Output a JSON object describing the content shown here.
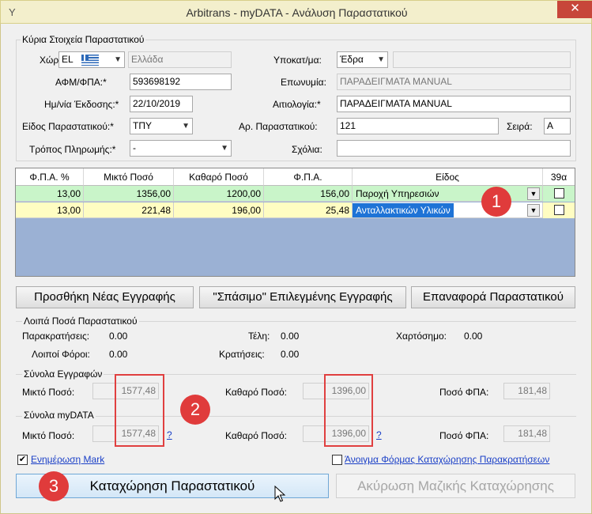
{
  "window": {
    "title": "Arbitrans - myDATA - Ανάλυση Παραστατικού",
    "close_glyph": "✕",
    "app_glyph": "Y"
  },
  "main_details": {
    "legend": "Κύρια Στοιχεία Παραστατικού",
    "country_label": "Χώρα:",
    "country_code": "EL",
    "country_name": "Ελλάδα",
    "vat_label": "ΑΦΜ/ΦΠΑ:*",
    "vat_value": "593698192",
    "date_label": "Ημ/νία Έκδοσης:*",
    "date_value": "22/10/2019",
    "doc_type_label": "Είδος Παραστατικού:*",
    "doc_type_value": "ΤΠΥ",
    "payment_label": "Τρόπος Πληρωμής:*",
    "payment_value": "-",
    "branch_label": "Υποκατ/μα:",
    "branch_value": "Έδρα",
    "branch_extra": "",
    "name_label": "Επωνυμία:",
    "name_value": "ΠΑΡΑΔΕΙΓΜΑΤΑ MANUAL",
    "reason_label": "Αιτιολογία:*",
    "reason_value": "ΠΑΡΑΔΕΙΓΜΑΤΑ MANUAL",
    "doc_no_label": "Αρ. Παραστατικού:",
    "doc_no_value": "121",
    "series_label": "Σειρά:",
    "series_value": "A",
    "notes_label": "Σχόλια:",
    "notes_value": ""
  },
  "grid": {
    "headers": [
      "Φ.Π.Α. %",
      "Μικτό Ποσό",
      "Καθαρό Ποσό",
      "Φ.Π.Α.",
      "Είδος",
      "39α"
    ],
    "rows": [
      {
        "vat_pct": "13,00",
        "gross": "1356,00",
        "net": "1200,00",
        "vat": "156,00",
        "kind": "Παροχή Υπηρεσιών",
        "c39a": false
      },
      {
        "vat_pct": "13,00",
        "gross": "221,48",
        "net": "196,00",
        "vat": "25,48",
        "kind": "Ανταλλακτικών Υλικών",
        "c39a": false
      }
    ]
  },
  "buttons": {
    "add": "Προσθήκη Νέας Εγγραφής",
    "split": "\"Σπάσιμο\" Επιλεγμένης Εγγραφής",
    "reset": "Επαναφορά Παραστατικού",
    "submit": "Καταχώρηση Παραστατικού",
    "cancel": "Ακύρωση Μαζικής Καταχώρησης"
  },
  "other_amounts": {
    "legend": "Λοιπά Ποσά Παραστατικού",
    "withholdings_label": "Παρακρατήσεις:",
    "withholdings_value": "0.00",
    "fees_label": "Τέλη:",
    "fees_value": "0.00",
    "stamp_label": "Χαρτόσημο:",
    "stamp_value": "0.00",
    "other_taxes_label": "Λοιποί Φόροι:",
    "other_taxes_value": "0.00",
    "deductions_label": "Κρατήσεις:",
    "deductions_value": "0.00"
  },
  "totals_entries": {
    "legend": "Σύνολα Εγγραφών",
    "gross_label": "Μικτό Ποσό:",
    "gross_value": "1577,48",
    "net_label": "Καθαρό Ποσό:",
    "net_value": "1396,00",
    "vat_label": "Ποσό ΦΠΑ:",
    "vat_value": "181,48"
  },
  "totals_mydata": {
    "legend": "Σύνολα myDATA",
    "gross_label": "Μικτό Ποσό:",
    "gross_value": "1577,48",
    "net_label": "Καθαρό Ποσό:",
    "net_value": "1396,00",
    "vat_label": "Ποσό ΦΠΑ:",
    "vat_value": "181,48",
    "help": "?"
  },
  "options": {
    "update_mark_label": "Ενημέρωση Mark",
    "update_mark_checked": true,
    "open_withholding_label": "Άνοιγμα Φόρμας Καταχώρησης Παρακρατήσεων",
    "open_withholding_checked": false
  },
  "annotations": {
    "badge1": "1",
    "badge2": "2",
    "badge3": "3"
  },
  "colors": {
    "row_selected": "#c9f5c9",
    "row_editing": "#fffdc2",
    "grid_empty": "#9bb1d4",
    "badge": "#e03b3b",
    "selection": "#1e73d6"
  }
}
